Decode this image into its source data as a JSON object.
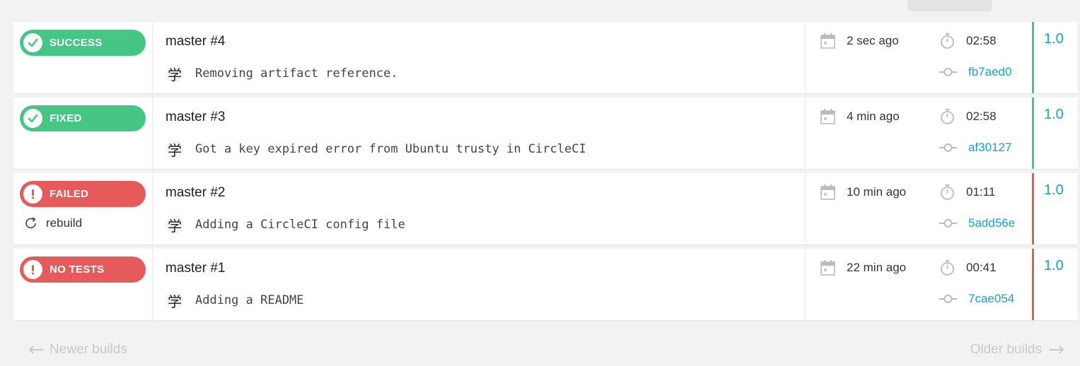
{
  "colors": {
    "success": "#45c685",
    "failed": "#e55a5a",
    "link": "#1b9fc8"
  },
  "icons": {
    "success": "check-circle-icon",
    "failed": "exclamation-circle-icon",
    "rebuild": "refresh-icon",
    "date": "calendar-icon",
    "duration": "stopwatch-icon",
    "commit": "git-commit-icon"
  },
  "builds": [
    {
      "status": "SUCCESS",
      "status_kind": "success",
      "title": "master #4",
      "avatar": "学",
      "message": "Removing artifact reference.",
      "time_ago": "2 sec ago",
      "duration": "02:58",
      "commit": "fb7aed0",
      "version": "1.0"
    },
    {
      "status": "FIXED",
      "status_kind": "success",
      "title": "master #3",
      "avatar": "学",
      "message": "Got a key expired error from Ubuntu trusty in CircleCI",
      "time_ago": "4 min ago",
      "duration": "02:58",
      "commit": "af30127",
      "version": "1.0"
    },
    {
      "status": "FAILED",
      "status_kind": "failed",
      "rebuild_label": "rebuild",
      "title": "master #2",
      "avatar": "学",
      "message": "Adding a CircleCI config file",
      "time_ago": "10 min ago",
      "duration": "01:11",
      "commit": "5add56e",
      "version": "1.0"
    },
    {
      "status": "NO TESTS",
      "status_kind": "failed",
      "title": "master #1",
      "avatar": "学",
      "message": "Adding a README",
      "time_ago": "22 min ago",
      "duration": "00:41",
      "commit": "7cae054",
      "version": "1.0"
    }
  ],
  "pagination": {
    "newer_label": "Newer builds",
    "older_label": "Older builds"
  }
}
